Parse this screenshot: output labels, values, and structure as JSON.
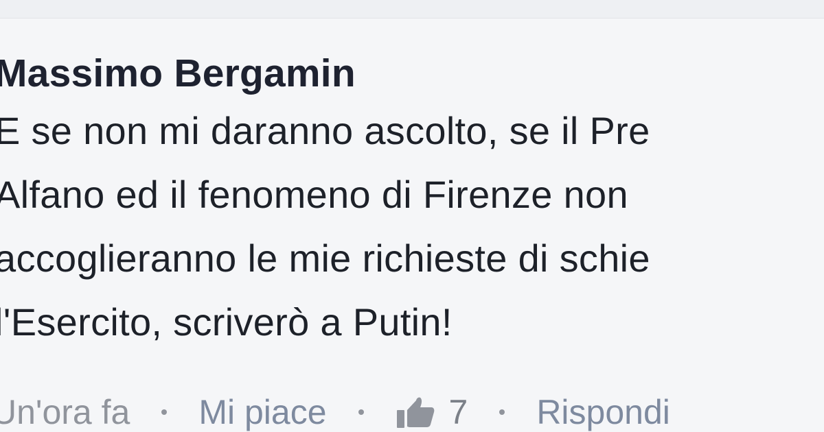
{
  "comment": {
    "author": "Massimo Bergamin",
    "lines": [
      "E se non mi daranno ascolto, se il Pre",
      "Alfano ed il fenomeno di Firenze non",
      "accoglieranno le mie richieste di schie",
      "l'Esercito, scriverò a Putin!"
    ]
  },
  "meta": {
    "timestamp": "Un'ora fa",
    "like_label": "Mi piace",
    "like_icon": "thumbs-up-icon",
    "like_count": "7",
    "reply_label": "Rispondi"
  }
}
